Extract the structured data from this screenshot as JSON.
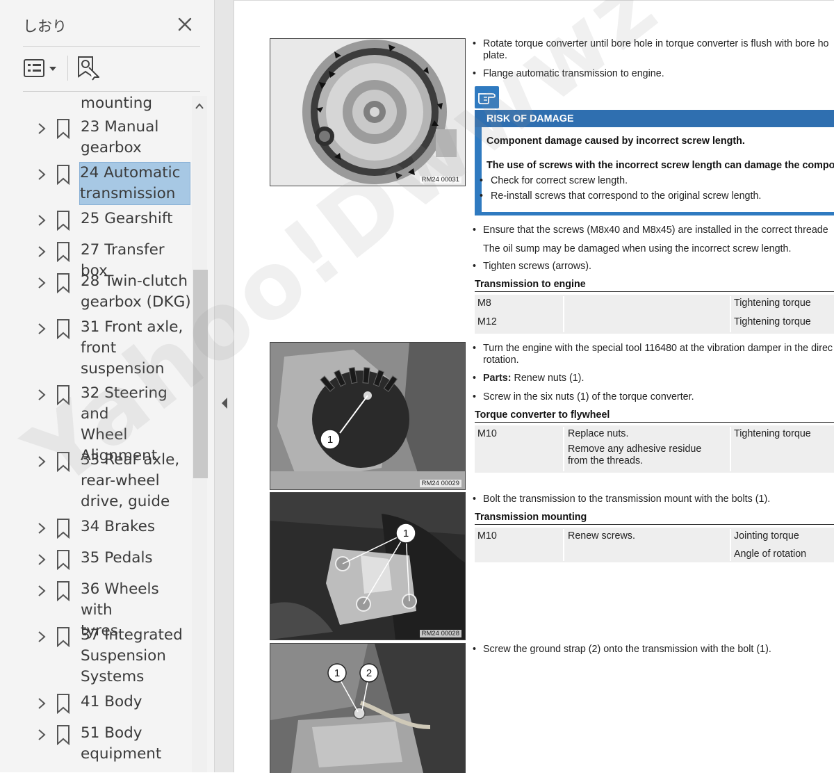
{
  "sidebar": {
    "title": "しおり",
    "close_icon": "close-icon",
    "options_icon": "list-options-icon",
    "new_bookmark_icon": "new-bookmark-icon",
    "items": [
      {
        "label": "mounting",
        "partial": true
      },
      {
        "label": "23 Manual\ngearbox"
      },
      {
        "label": "24 Automatic\ntransmission",
        "selected": true
      },
      {
        "label": "25 Gearshift"
      },
      {
        "label": "27 Transfer box"
      },
      {
        "label": "28 Twin-clutch\ngearbox (DKG)"
      },
      {
        "label": "31 Front axle,\nfront\nsuspension"
      },
      {
        "label": "32 Steering and\nWheel\nAlignment"
      },
      {
        "label": "33 Rear axle,\nrear-wheel\ndrive, guide"
      },
      {
        "label": "34 Brakes"
      },
      {
        "label": "35 Pedals"
      },
      {
        "label": "36 Wheels with\ntyres"
      },
      {
        "label": "37 Integrated\nSuspension\nSystems"
      },
      {
        "label": "41 Body"
      },
      {
        "label": "51 Body\nequipment"
      }
    ]
  },
  "document": {
    "photos": [
      {
        "code": "RM24 00031",
        "callouts": []
      },
      {
        "code": "RM24 00029",
        "callouts": [
          "1"
        ]
      },
      {
        "code": "RM24 00028",
        "callouts": [
          "1"
        ]
      },
      {
        "code": "",
        "callouts": [
          "1",
          "2"
        ]
      }
    ],
    "step1": {
      "b1": "Rotate torque converter until bore hole in torque converter is flush with bore ho\nplate.",
      "b2": "Flange automatic transmission to engine."
    },
    "risk": {
      "icon": "hand-pointing-icon",
      "title": "RISK OF DAMAGE",
      "line1": "Component damage caused by incorrect screw length.",
      "line2": "The use of screws with the incorrect screw length can damage the compon",
      "bullet1": "Check for correct screw length.",
      "bullet2": "Re-install screws that correspond to the original screw length."
    },
    "step1b": {
      "b3": "Ensure that the screws (M8x40 and M8x45) are installed in the correct threade",
      "note": "The oil sump may be damaged when using the incorrect screw length.",
      "b4": "Tighten screws (arrows)."
    },
    "table1": {
      "title": "Transmission to engine",
      "rows": [
        {
          "size": "M8",
          "note": "",
          "spec": "Tightening torque"
        },
        {
          "size": "M12",
          "note": "",
          "spec": "Tightening torque"
        }
      ]
    },
    "step2": {
      "b1": "Turn the engine with the special tool 116480 at the vibration damper in the direc\nrotation.",
      "parts_label": "Parts:",
      "parts_text": " Renew nuts (1).",
      "b3": "Screw in the six nuts (1) of the torque converter."
    },
    "table2": {
      "title": "Torque converter to flywheel",
      "rows": [
        {
          "size": "M10",
          "note1": "Replace nuts.",
          "note2": "Remove any adhesive residue\nfrom the threads.",
          "spec": "Tightening torque"
        }
      ]
    },
    "step3": {
      "b1": "Bolt the transmission to the transmission mount with the bolts (1)."
    },
    "table3": {
      "title": "Transmission mounting",
      "rows": [
        {
          "size": "M10",
          "note": "Renew screws.",
          "spec1": "Jointing torque",
          "spec2": "Angle of rotation"
        }
      ]
    },
    "step4": {
      "b1": "Screw the ground strap (2) onto the transmission with the bolt (1)."
    }
  },
  "watermark": "Yahoo!Dwwwz",
  "colors": {
    "risk_blue": "#2f7ac0",
    "selection": "#a7c8e4",
    "table_bg": "#eeeeee"
  }
}
